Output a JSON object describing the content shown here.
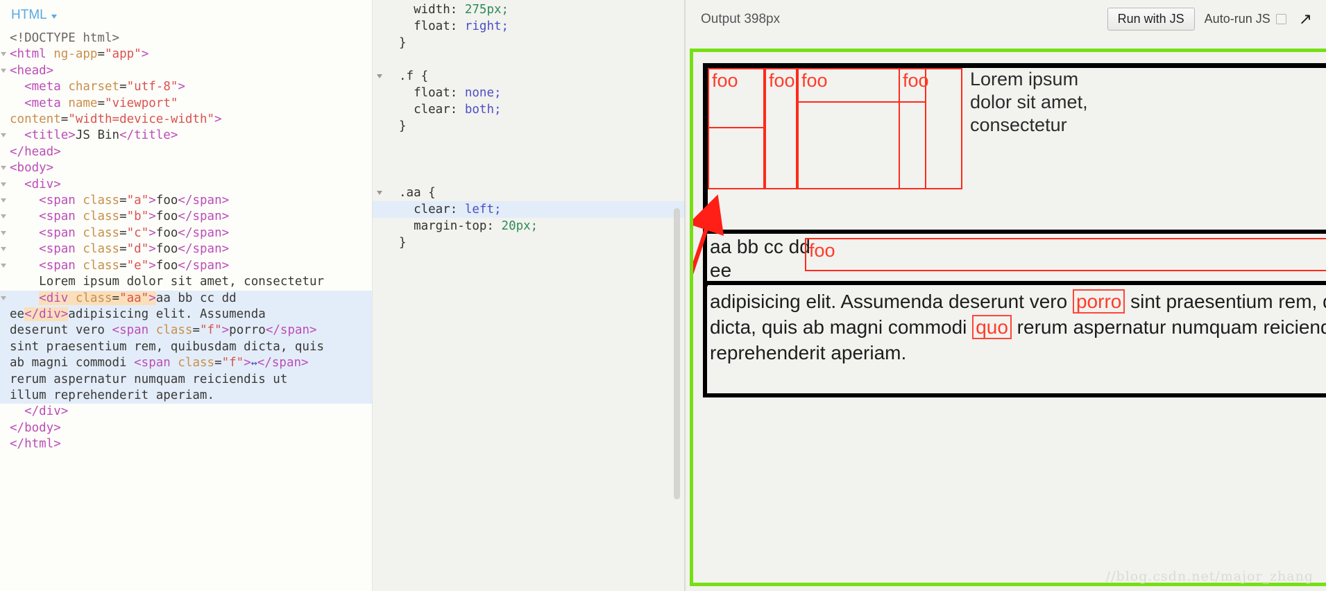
{
  "html_panel": {
    "label": "HTML",
    "dropdown_icon": "chevron-down-icon",
    "lines": [
      "<!DOCTYPE html>",
      "<html ng-app=\"app\">",
      "<head>",
      "  <meta charset=\"utf-8\">",
      "  <meta name=\"viewport\"",
      "content=\"width=device-width\">",
      "  <title>JS Bin</title>",
      "</head>",
      "<body>",
      "  <div>",
      "    <span class=\"a\">foo</span>",
      "    <span class=\"b\">foo</span>",
      "    <span class=\"c\">foo</span>",
      "    <span class=\"d\">foo</span>",
      "    <span class=\"e\">foo</span>",
      "    Lorem ipsum dolor sit amet, consectetur",
      "    <div class=\"aa\">aa bb cc dd ee</div>adipisicing elit. Assumenda deserunt vero <span class=\"f\">porro</span> sint praesentium rem, quibusdam dicta, quis ab magni commodi <span class=\"f\">quo</span> rerum aspernatur numquam reiciendis ut illum reprehenderit aperiam.",
      "  </div>",
      "</body>",
      "</html>"
    ],
    "tokens": {
      "doctype": "<!DOCTYPE html>",
      "html_open_tag": "<html",
      "ng_app_attr": "ng-app",
      "ng_app_value": "\"app\"",
      "head_open": "<head>",
      "meta": "meta",
      "charset_attr": "charset",
      "charset_value": "\"utf-8\"",
      "name_attr": "name",
      "name_value": "\"viewport\"",
      "content_attr": "content",
      "content_value": "\"width=device-width\"",
      "title_open": "<title>",
      "title_text": "JS Bin",
      "title_close": "</title>",
      "head_close": "</head>",
      "body_open": "<body>",
      "div_open": "<div>",
      "span": "span",
      "class_attr": "class",
      "foo_text": "foo",
      "span_close": "</span>",
      "class_a": "\"a\"",
      "class_b": "\"b\"",
      "class_c": "\"c\"",
      "class_d": "\"d\"",
      "class_e": "\"e\"",
      "class_f": "\"f\"",
      "class_aa": "\"aa\"",
      "lorem_line": "Lorem ipsum dolor sit amet, consectetur",
      "aa_div_open": "<div class=\"aa\">",
      "aa_content": "aa bb cc dd",
      "ee_text": "ee",
      "aa_div_close": "</div>",
      "after_div": "adipisicing elit. Assumenda",
      "line_deserunt": "deserunt vero ",
      "porro_text": "porro",
      "line_sint": "sint praesentium rem, quibusdam dicta, quis",
      "line_abmagni": "ab magni commodi ",
      "quo_glyph": "↔",
      "line_rerum": "rerum aspernatur numquam reiciendis ut",
      "line_illum": "illum reprehenderit aperiam.",
      "div_close": "</div>",
      "body_close": "</body>",
      "html_close": "</html>"
    }
  },
  "css_panel": {
    "lines": [
      "    width: 275px;",
      "    float: right;",
      "}",
      ".f {",
      "    float: none;",
      "    clear: both;",
      "}",
      ".aa {",
      "    clear: left;",
      "    margin-top: 20px;",
      "}"
    ],
    "tokens": {
      "prop_width": "width:",
      "val_275px": "275px;",
      "prop_float": "float:",
      "val_right": "right;",
      "brace_close": "}",
      "sel_f": ".f {",
      "val_none": "none;",
      "prop_clear": "clear:",
      "val_both": "both;",
      "sel_aa": ".aa {",
      "val_left": "left;",
      "prop_margin_top": "margin-top:",
      "val_20px": "20px;"
    }
  },
  "output_panel": {
    "title": "Output 398px",
    "run_button": "Run with JS",
    "autorun_label": "Auto-run JS",
    "autorun_checked": false,
    "expand_icon": "↗",
    "preview": {
      "foo_boxes": [
        "foo",
        "foo",
        "foo",
        "foo"
      ],
      "lorem_text": "Lorem ipsum dolor sit amet, consectetur",
      "aa_text": "aa bb cc dd",
      "ee_text": "ee",
      "aa_foo": "foo",
      "paragraph_prefix": "adipisicing elit. Assumenda deserunt vero ",
      "porro": "porro",
      "paragraph_mid": " sint praesentium rem, quibusdam dicta, quis ab magni commodi ",
      "quo": "quo",
      "paragraph_suffix": " rerum aspernatur numquam reiciendis ut illum reprehenderit aperiam."
    }
  },
  "watermark": "//blog.csdn.net/major_zhang",
  "colors": {
    "accent_green": "#76e012",
    "annotation_red": "#ff1f16",
    "box_red": "#ff2a1a",
    "panel_label_blue": "#5aa9e6",
    "selection_blue": "#e3edf9",
    "highlight_orange": "#fadfbb"
  }
}
